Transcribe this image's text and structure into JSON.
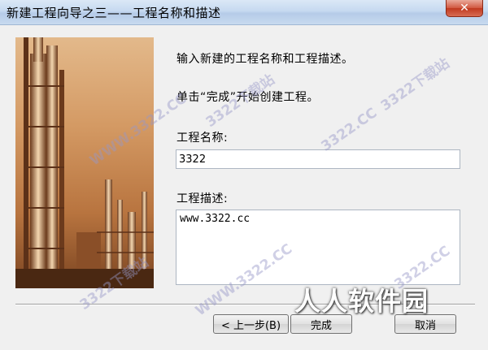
{
  "window": {
    "title": "新建工程向导之三——工程名称和描述",
    "close_label": "✕"
  },
  "intro": {
    "line1": "输入新建的工程名称和工程描述。",
    "line2": "单击“完成”开始创建工程。"
  },
  "project_name": {
    "label": "工程名称:",
    "value": "3322"
  },
  "project_desc": {
    "label": "工程描述:",
    "value": "www.3322.cc"
  },
  "buttons": {
    "back": "< 上一步(B)",
    "finish": "完成",
    "cancel": "取消"
  },
  "watermarks": [
    "3322下载站",
    "WWW.3322.CC",
    "3322.CC",
    "3322下载站",
    "WWW.3322.CC",
    "3322下载站",
    "3322.CC"
  ],
  "brand_mark": "人人软件园",
  "colors": {
    "titlebar": "#c6d9f0",
    "close": "#c0391f",
    "banner": "#d49a64"
  }
}
